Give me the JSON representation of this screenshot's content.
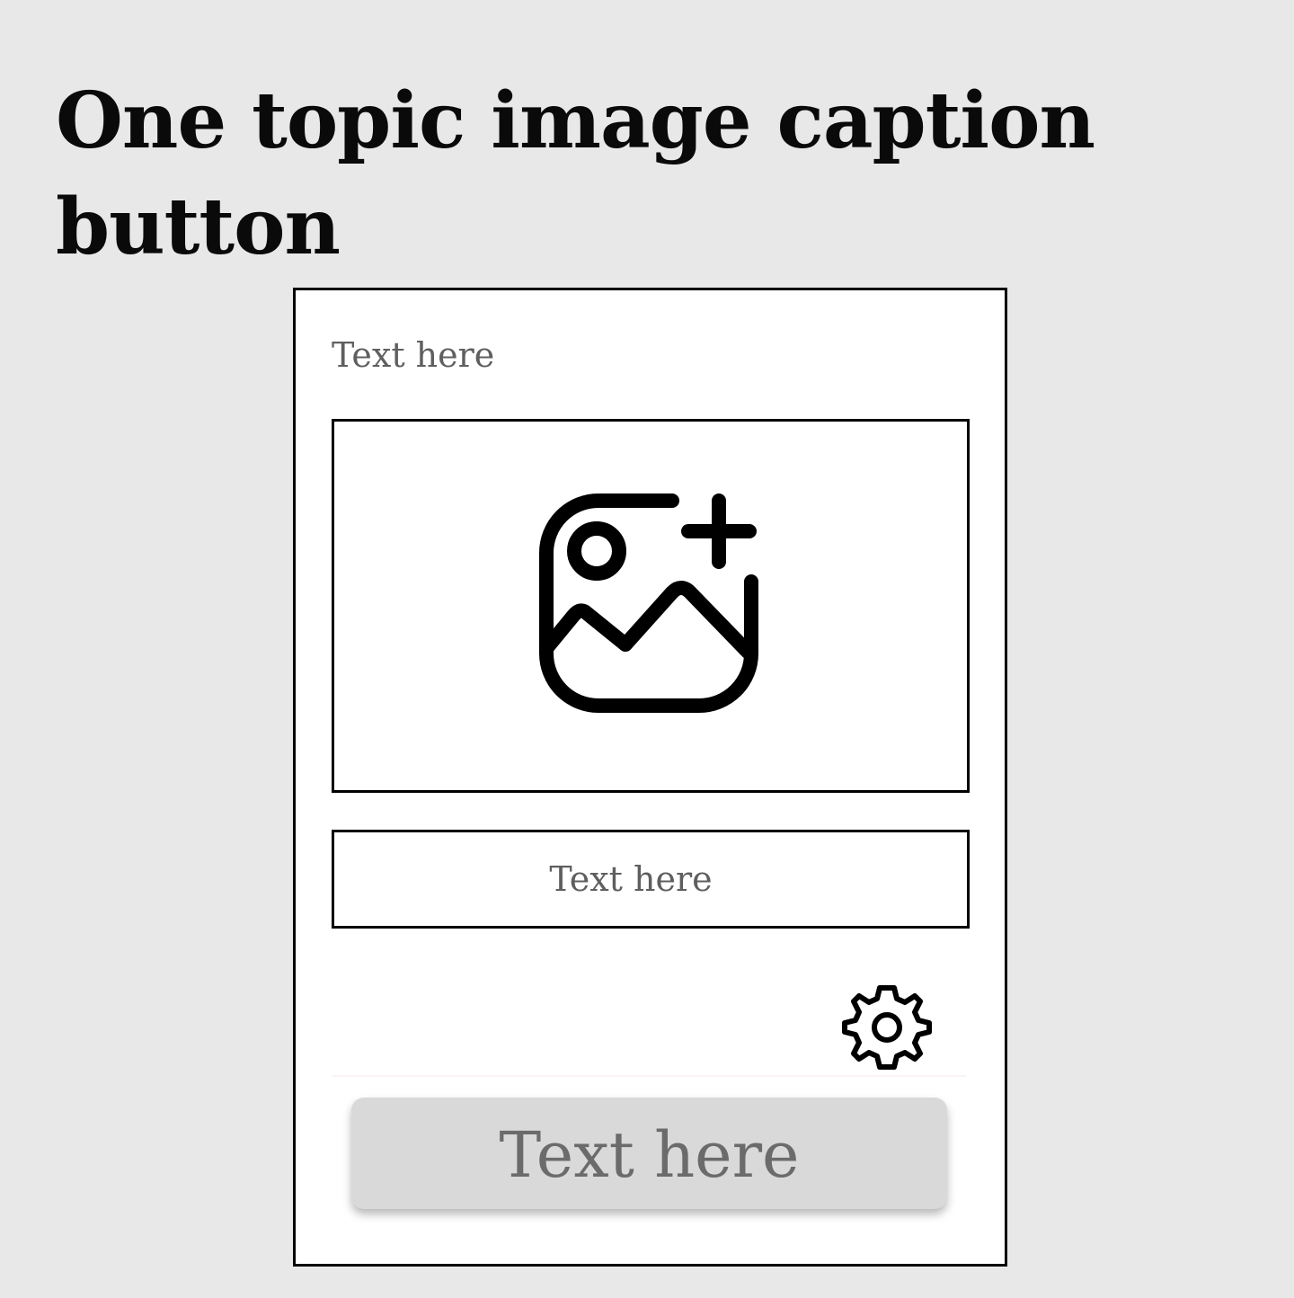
{
  "page": {
    "title": "One topic image caption button"
  },
  "card": {
    "header_label": "Text here",
    "image_placeholder": {
      "icon": "image-add-icon"
    },
    "caption": {
      "placeholder": "Text here"
    },
    "settings": {
      "icon": "gear-icon"
    },
    "button": {
      "label": "Text here"
    }
  },
  "colors": {
    "background": "#e8e8e8",
    "card": "#ffffff",
    "border": "#000000",
    "placeholder_text": "#5f5f5f",
    "button_fill": "#d9d9d9",
    "button_text": "#6b6b6b"
  }
}
